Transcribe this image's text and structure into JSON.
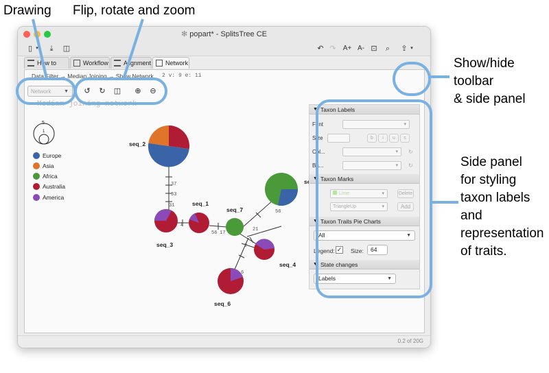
{
  "callouts": {
    "drawing": "Drawing",
    "flip": "Flip, rotate and zoom",
    "showhide": [
      "Show/hide",
      "toolbar",
      "& side panel"
    ],
    "sidepanel": [
      "Side panel",
      "for styling",
      "taxon labels",
      "and",
      "representation",
      "of traits."
    ]
  },
  "window": {
    "title": "popart* - SplitsTree CE"
  },
  "toolbar": {
    "font_up": "A+",
    "font_down": "A-"
  },
  "tabs": [
    {
      "label": "How to Cite"
    },
    {
      "label": "Workflow"
    },
    {
      "label": "Alignment"
    },
    {
      "label": "Network"
    }
  ],
  "breadcrumb": "Data Filter → Median Joining → Show Network",
  "stats": "2   v: 9   e: 11",
  "diagram_combo": "Network",
  "graph_title": "Median-joining network",
  "legend": {
    "size_max": "5",
    "size_min": "1",
    "items": [
      {
        "label": "Europe",
        "color": "#3b63a8"
      },
      {
        "label": "Asia",
        "color": "#e07428"
      },
      {
        "label": "Africa",
        "color": "#4a9a3a"
      },
      {
        "label": "Australia",
        "color": "#b01c34"
      },
      {
        "label": "America",
        "color": "#8a4ab8"
      }
    ]
  },
  "nodes": {
    "seq_1": "seq_1",
    "seq_2": "seq_2",
    "seq_3": "seq_3",
    "seq_4": "seq_4",
    "seq_5": "seq_",
    "seq_6": "seq_6",
    "seq_7": "seq_7"
  },
  "edge_labels": [
    "40",
    "37",
    "33",
    "31",
    "1",
    "56",
    "17",
    "21",
    "56",
    "2",
    "6"
  ],
  "side_panel": {
    "taxon_labels": "Taxon Labels",
    "font": "Font",
    "size": "Size",
    "bold": "b",
    "italic": "i",
    "underline": "u",
    "strike": "s",
    "color": "Col...",
    "background": "Ba...",
    "taxon_marks": "Taxon Marks",
    "mark_color": "Lime",
    "delete": "Delete",
    "mark_shape": "TriangleUp",
    "add": "Add",
    "pie_charts": "Taxon Traits Pie Charts",
    "trait": "All",
    "legend_label": "Legend:",
    "size_label": "Size:",
    "size_value": "64",
    "state_changes": "State changes",
    "state_value": "Labels"
  },
  "status": "0.2 of 20G"
}
